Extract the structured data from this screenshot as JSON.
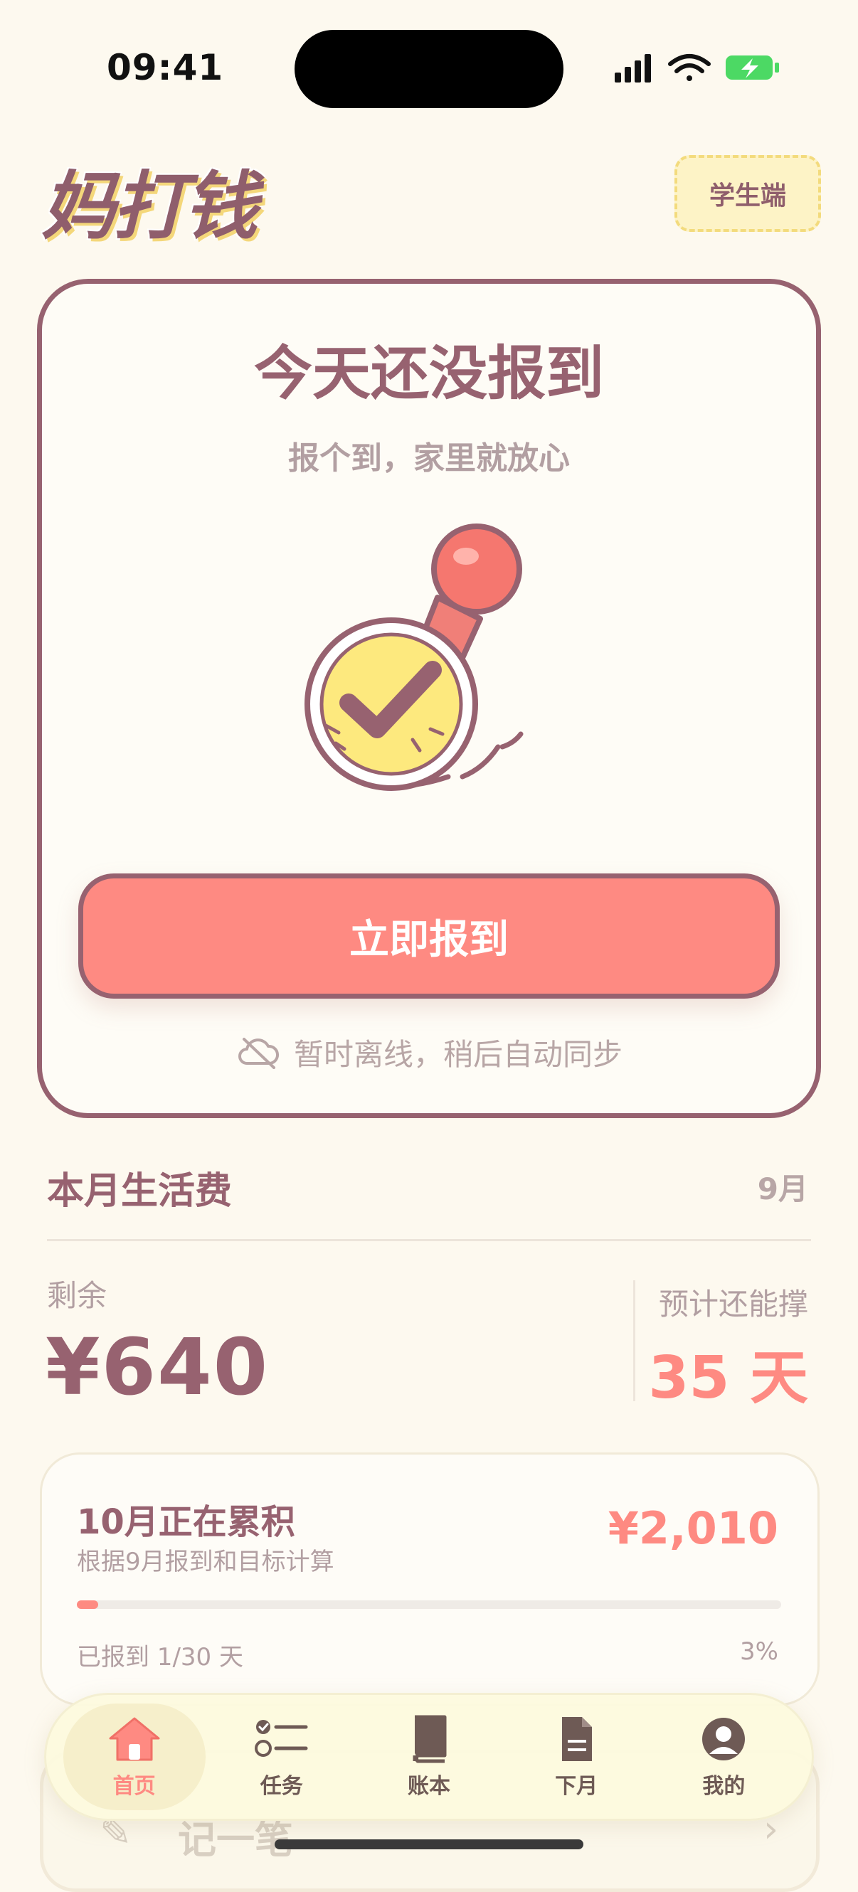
{
  "status_bar": {
    "time": "09:41"
  },
  "header": {
    "logo": "妈打钱",
    "role_badge": "学生端"
  },
  "checkin_card": {
    "title": "今天还没报到",
    "subtitle": "报个到，家里就放心",
    "button_label": "立即报到",
    "offline_text": "暂时离线，稍后自动同步"
  },
  "budget": {
    "title": "本月生活费",
    "month": "9月",
    "remaining_label": "剩余",
    "remaining_amount": "¥640",
    "days_label": "预计还能撑",
    "days_value": "35 天"
  },
  "accumulate": {
    "title": "10月正在累积",
    "subtitle": "根据9月报到和目标计算",
    "amount": "¥2,010",
    "progress_text": "已报到 1/30 天",
    "progress_percent_text": "3%",
    "progress_fraction": 0.03
  },
  "peek_row": {
    "label": "记一笔"
  },
  "tabbar": {
    "items": [
      {
        "label": "首页",
        "icon": "home-icon",
        "active": true
      },
      {
        "label": "任务",
        "icon": "task-list-icon",
        "active": false
      },
      {
        "label": "账本",
        "icon": "ledger-book-icon",
        "active": false
      },
      {
        "label": "下月",
        "icon": "document-icon",
        "active": false
      },
      {
        "label": "我的",
        "icon": "profile-icon",
        "active": false
      }
    ]
  },
  "colors": {
    "primary": "#976270",
    "accent": "#fe8a82",
    "background": "#fdf9ef",
    "badge_bg": "#fdf3c6",
    "stamp_yellow": "#fde97e"
  }
}
